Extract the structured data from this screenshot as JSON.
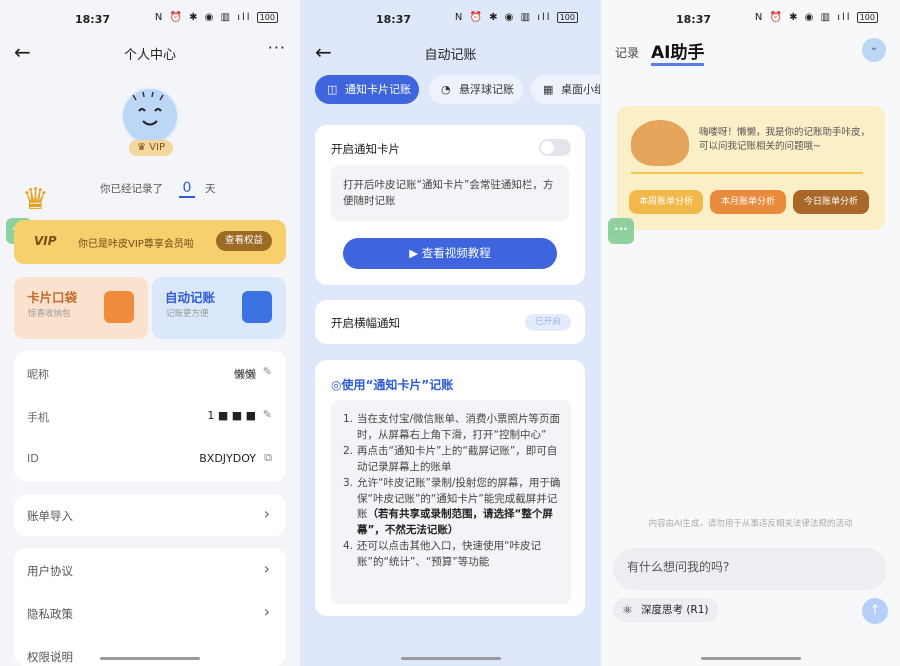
{
  "status": {
    "time": "18:37",
    "icons": "N ⏰ ✱ ◉ ▥ ıll",
    "battery": "100"
  },
  "p1": {
    "title": "个人中心",
    "back": "←",
    "more": "···",
    "vip_badge": "VIP",
    "record_prefix": "你已经记录了",
    "record_days": "0",
    "record_suffix": "天",
    "vip_logo": "VIP",
    "vip_text": "你已是咔皮VIP尊享会员啦",
    "vip_button": "查看权益",
    "tiles": [
      {
        "title": "卡片口袋",
        "sub": "惊喜收纳包"
      },
      {
        "title": "自动记账",
        "sub": "记账更方便"
      }
    ],
    "info": [
      {
        "label": "昵称",
        "value": "懒懒"
      },
      {
        "label": "手机",
        "value": "1 ■ ■          ■"
      },
      {
        "label": "ID",
        "value": "BXDJYDOY"
      }
    ],
    "import": "账单导入",
    "agreements": [
      "用户协议",
      "隐私政策",
      "权限说明"
    ],
    "float": "···"
  },
  "p2": {
    "title": "自动记账",
    "back": "←",
    "tabs": [
      "通知卡片记账",
      "悬浮球记账",
      "桌面小组件"
    ],
    "switch1_label": "开启通知卡片",
    "hint": "打开后咔皮记账“通知卡片”会常驻通知栏，方便随时记账",
    "video_btn": "查看视频教程",
    "switch2_label": "开启横幅通知",
    "switch2_state": "已开启",
    "guide_title": "使用“通知卡片”记账",
    "steps": [
      "当在支付宝/微信账单、消费小票照片等页面时，从屏幕右上角下滑，打开“控制中心”",
      "再点击“通知卡片”上的“截屏记账”，即可自动记录屏幕上的账单",
      "允许“咔皮记账”录制/投射您的屏幕，用于确保“咔皮记账”的“通知卡片”能完成截屏并记账",
      "还可以点击其他入口，快速使用“咔皮记账”的“统计”、“预算”等功能"
    ],
    "step3_bold": "（若有共享或录制范围，请选择“整个屏幕”，不然无法记账）"
  },
  "p3": {
    "tab_record": "记录",
    "tab_ai": "AI助手",
    "greeting": "嗨喽呀！懒懒，我是你的记账助手咔皮，可以问我记账相关的问题哦~",
    "quick": [
      "本周账单分析",
      "本月账单分析",
      "今日账单分析"
    ],
    "disclaimer": "内容由AI生成，请勿用于从事违反相关法律法规的活动",
    "input_placeholder": "有什么想问我的吗?",
    "deep_think": "深度思考 (R1)",
    "send": "↑"
  }
}
